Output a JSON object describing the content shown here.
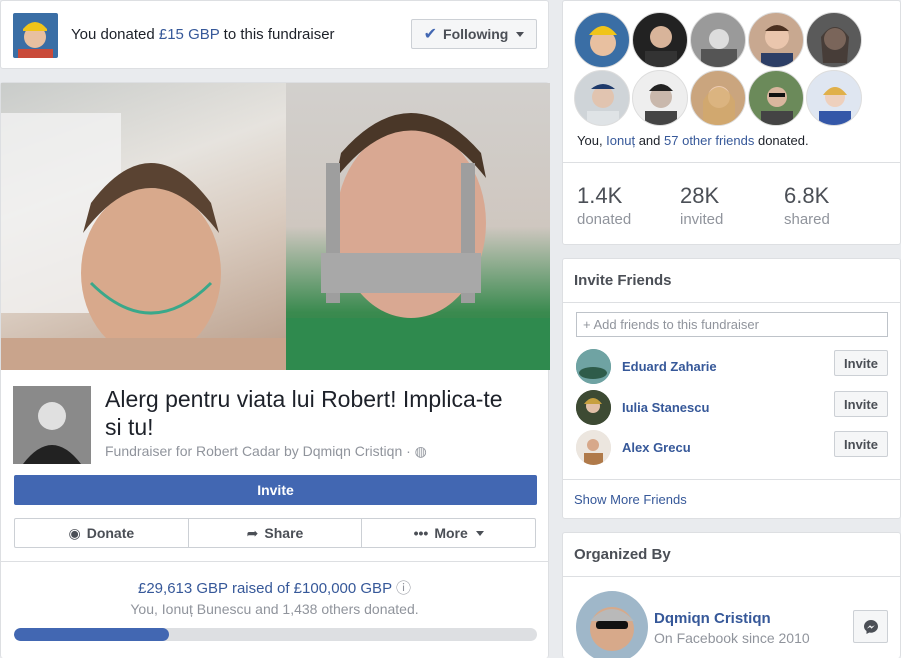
{
  "header": {
    "donated_prefix": "You donated ",
    "donated_amount": "£15 GBP",
    "donated_suffix": " to this fundraiser",
    "following_label": "Following"
  },
  "fundraiser": {
    "title": "Alerg pentru viata lui Robert! Implica-te si tu!",
    "subtitle": "Fundraiser for Robert Cadar by Dqmiqn Cristiqn ·",
    "invite_label": "Invite",
    "actions": {
      "donate": "Donate",
      "share": "Share",
      "more": "More"
    },
    "raised_text": "£29,613 GBP raised of £100,000 GBP",
    "donors_text": "You, Ionuț Bunescu and 1,438 others donated.",
    "progress_fraction": 0.296
  },
  "friends_donated": {
    "you": "You, ",
    "friend": "Ionuț",
    "and": " and ",
    "others": "57 other friends",
    "suffix": " donated."
  },
  "stats": [
    {
      "value": "1.4K",
      "label": "donated"
    },
    {
      "value": "28K",
      "label": "invited"
    },
    {
      "value": "6.8K",
      "label": "shared"
    }
  ],
  "invite_friends": {
    "heading": "Invite Friends",
    "placeholder": "+ Add friends to this fundraiser",
    "friends": [
      {
        "name": "Eduard Zaharie",
        "button": "Invite"
      },
      {
        "name": "Iulia Stanescu",
        "button": "Invite"
      },
      {
        "name": "Alex Grecu",
        "button": "Invite"
      }
    ],
    "show_more": "Show More Friends"
  },
  "organized_by": {
    "heading": "Organized By",
    "name": "Dqmiqn Cristiqn",
    "since": "On Facebook since 2010"
  },
  "colors": {
    "brand": "#4267b2",
    "link": "#365899",
    "muted": "#90949c"
  }
}
